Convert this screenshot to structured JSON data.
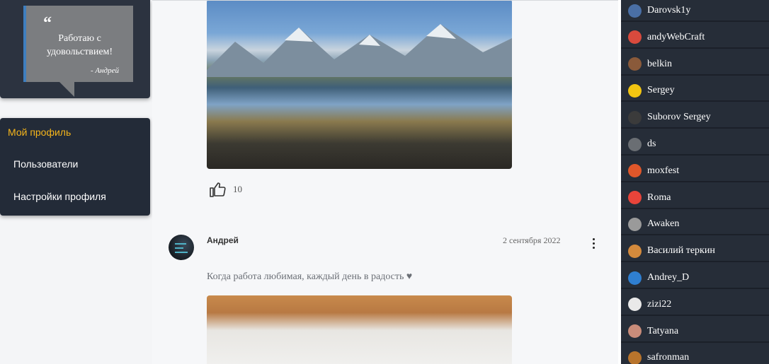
{
  "quote": {
    "mark": "“",
    "text": "Работаю с удовольствием!",
    "author": "- Андрей"
  },
  "menu": {
    "title": "Мой профиль",
    "items": [
      {
        "label": "Пользователи"
      },
      {
        "label": "Настройки профиля"
      }
    ]
  },
  "feed": {
    "post1": {
      "likes": "10"
    },
    "post2": {
      "author": "Андрей",
      "date": "2 сентября 2022",
      "text": "Когда работа любимая, каждый день в радость",
      "heart": "♥"
    }
  },
  "colors": {
    "accent": "#f5b51b",
    "panel": "#262d38",
    "quote_border": "#3f7fbf"
  },
  "online_users": [
    {
      "name": "Darovsk1y",
      "avatar_color": "#4a6fa5"
    },
    {
      "name": "andyWebCraft",
      "avatar_color": "#d94a3d"
    },
    {
      "name": "belkin",
      "avatar_color": "#8a5a3a"
    },
    {
      "name": "Sergey",
      "avatar_color": "#f2c511"
    },
    {
      "name": "Suborov Sergey",
      "avatar_color": "#3b3b3b"
    },
    {
      "name": "ds",
      "avatar_color": "#6a6e73"
    },
    {
      "name": "moxfest",
      "avatar_color": "#e0572a"
    },
    {
      "name": "Roma",
      "avatar_color": "#e8443a"
    },
    {
      "name": "Awaken",
      "avatar_color": "#9a9a9a"
    },
    {
      "name": "Василий теркин",
      "avatar_color": "#d48a3c"
    },
    {
      "name": "Andrey_D",
      "avatar_color": "#2f7fd1"
    },
    {
      "name": "zizi22",
      "avatar_color": "#e9e9e9"
    },
    {
      "name": "Tatyana",
      "avatar_color": "#c98c7a"
    },
    {
      "name": "safronman",
      "avatar_color": "#b8742c"
    }
  ]
}
